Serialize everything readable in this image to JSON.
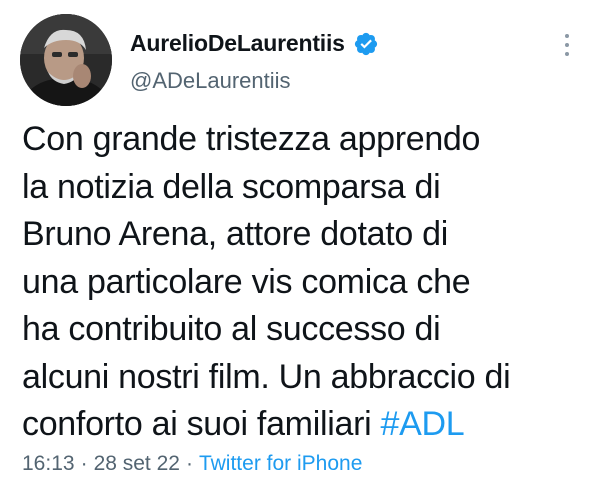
{
  "author": {
    "display_name": "AurelioDeLaurentiis",
    "handle": "@ADeLaurentiis",
    "verified": true,
    "avatar_icon": "profile-photo"
  },
  "tweet": {
    "lines": [
      "Con grande tristezza apprendo",
      "la notizia della scomparsa di",
      "Bruno Arena, attore dotato di",
      "una particolare vis comica che",
      "ha contribuito al successo di",
      "alcuni nostri film. Un abbraccio di",
      "conforto ai suoi familiari "
    ],
    "hashtag": "#ADL"
  },
  "meta": {
    "time": "16:13",
    "separator": "·",
    "date": "28 set 22",
    "source": "Twitter for iPhone"
  },
  "colors": {
    "text": "#0f1419",
    "secondary": "#536471",
    "link": "#1d9bf0",
    "verified": "#1d9bf0"
  },
  "icons": {
    "verified": "verified-badge-icon",
    "more": "more-options-icon"
  }
}
